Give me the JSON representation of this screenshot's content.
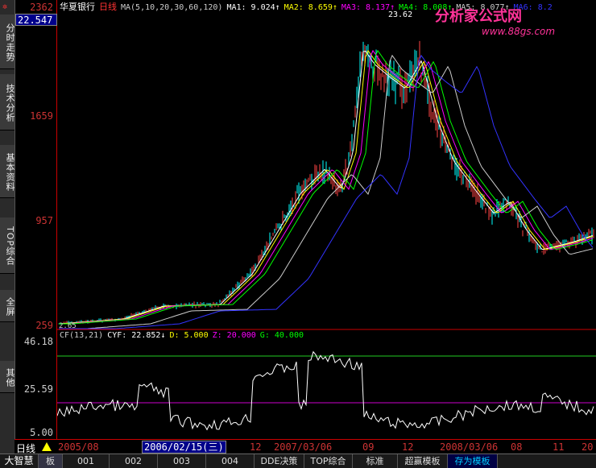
{
  "sidebar": {
    "tabs": [
      "分时走势",
      "技术分析",
      "基本资料",
      "TOP综合",
      "全屏",
      "其他"
    ]
  },
  "header": {
    "stock_name": "华夏银行",
    "period": "日线",
    "ma_params": "MA(5,10,20,30,60,120)",
    "ma1": "MA1: 9.024↑",
    "ma2": "MA2: 8.659↑",
    "ma3": "MA3: 8.137↑",
    "ma4": "MA4: 8.008↑",
    "ma5": "MA5: 8.077↑",
    "ma6": "MA6: 8.2"
  },
  "price_axis": {
    "labels": [
      "2362",
      "1659",
      "957",
      "259"
    ],
    "current_value": "22.547",
    "peak_label": "23.62",
    "low_label": "2.65"
  },
  "indicator": {
    "title": "CF(13,21)",
    "cyf": "CYF: 22.852↓",
    "d": "D: 5.000",
    "z": "Z: 20.000",
    "g": "G: 40.000",
    "axis_labels": [
      "46.18",
      "25.59",
      "5.00"
    ]
  },
  "date_axis": {
    "labels": [
      "2005/08",
      "12",
      "2007/03/06",
      "09",
      "12",
      "2008/03/06",
      "08",
      "11",
      "20"
    ],
    "cursor_date": "2006/02/15(三)",
    "period_label": "日线"
  },
  "bottom_tabs": [
    "大智慧",
    "板",
    "001",
    "002",
    "003",
    "004",
    "DDE决策",
    "TOP综合",
    "标准",
    "超赢模板",
    "存为模板"
  ],
  "watermark": {
    "title": "分析家公式网",
    "url": "www.88gs.com"
  },
  "colors": {
    "ma1": "#ffffff",
    "ma2": "#ffff00",
    "ma3": "#ff00ff",
    "ma4": "#00ff00",
    "ma5": "#cccccc",
    "ma6": "#3333ff",
    "axis": "#cc2222"
  }
}
